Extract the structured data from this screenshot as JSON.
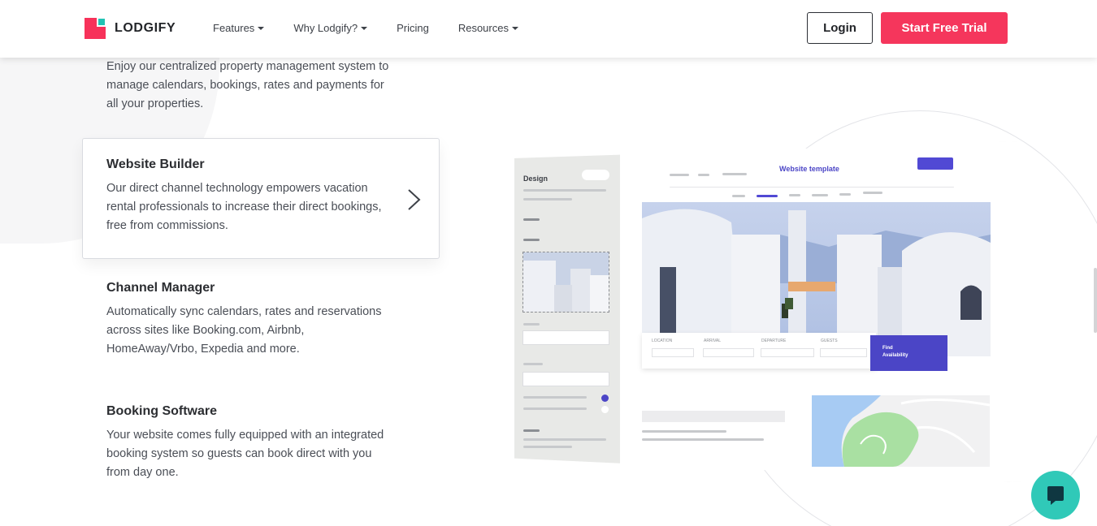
{
  "header": {
    "brand": "LODGIFY",
    "nav": [
      {
        "label": "Features",
        "dropdown": true
      },
      {
        "label": "Why Lodgify?",
        "dropdown": true
      },
      {
        "label": "Pricing",
        "dropdown": false
      },
      {
        "label": "Resources",
        "dropdown": true
      }
    ],
    "login_label": "Login",
    "trial_label": "Start Free Trial"
  },
  "features": [
    {
      "title": "",
      "description": "Enjoy our centralized property management system to manage calendars, bookings, rates and payments for all your properties."
    },
    {
      "title": "Website Builder",
      "description": "Our direct channel technology empowers vacation rental professionals to increase their direct bookings, free from commissions.",
      "active": true
    },
    {
      "title": "Channel Manager",
      "description": "Automatically sync calendars, rates and reservations across sites like Booking.com, Airbnb, HomeAway/Vrbo, Expedia and more."
    },
    {
      "title": "Booking Software",
      "description": "Your website comes fully equipped with an integrated booking system so guests can book direct with you from day one."
    }
  ],
  "mockup": {
    "sidebar_label": "Design",
    "title": "Website template",
    "search_fields": [
      "LOCATION",
      "ARRIVAL",
      "DEPARTURE",
      "GUESTS"
    ],
    "find_label_line1": "Find",
    "find_label_line2": "Availability"
  },
  "colors": {
    "brand_red": "#f5365c",
    "brand_teal": "#22c3b4",
    "mockup_accent": "#4b45c6",
    "chat_teal": "#30c9b8"
  },
  "icons": {
    "next": "chevron-right-icon",
    "chat": "chat-bubble-icon"
  }
}
